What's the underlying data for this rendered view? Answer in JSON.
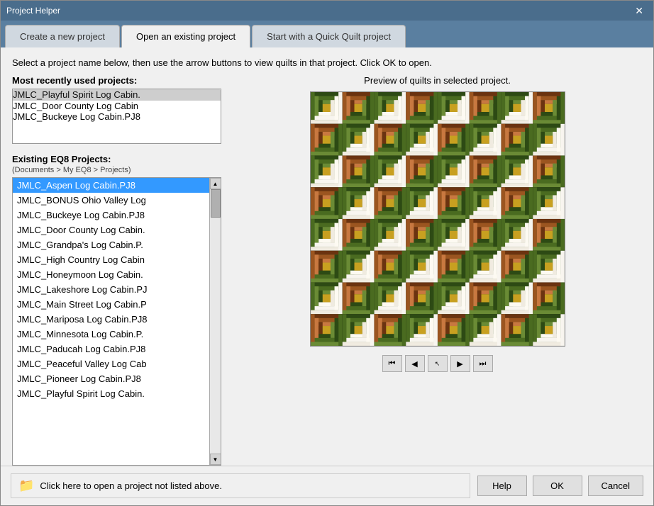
{
  "window": {
    "title": "Project Helper",
    "close_label": "✕"
  },
  "tabs": [
    {
      "id": "new",
      "label": "Create a new project",
      "active": false
    },
    {
      "id": "open",
      "label": "Open an existing project",
      "active": true
    },
    {
      "id": "quick",
      "label": "Start with a Quick Quilt project",
      "active": false
    }
  ],
  "instruction": "Select a project name below, then use the arrow buttons to view quilts in that project. Click OK to open.",
  "recent_section": {
    "label": "Most recently used projects:",
    "items": [
      "JMLC_Playful Spirit Log Cabin.",
      "JMLC_Door County Log Cabin",
      "JMLC_Buckeye Log Cabin.PJ8"
    ]
  },
  "existing_section": {
    "label": "Existing EQ8 Projects:",
    "sublabel": "(Documents > My EQ8 > Projects)",
    "items": [
      "JMLC_Aspen Log Cabin.PJ8",
      "JMLC_BONUS Ohio Valley Log",
      "JMLC_Buckeye Log Cabin.PJ8",
      "JMLC_Door County Log Cabin.",
      "JMLC_Grandpa's Log Cabin.P.",
      "JMLC_High Country Log Cabin",
      "JMLC_Honeymoon Log Cabin.",
      "JMLC_Lakeshore Log Cabin.PJ",
      "JMLC_Main Street Log Cabin.P",
      "JMLC_Mariposa Log Cabin.PJ8",
      "JMLC_Minnesota Log Cabin.P.",
      "JMLC_Paducah Log Cabin.PJ8",
      "JMLC_Peaceful Valley Log Cab",
      "JMLC_Pioneer Log Cabin.PJ8",
      "JMLC_Playful Spirit Log Cabin."
    ],
    "selected_index": 0
  },
  "preview": {
    "label": "Preview of quilts in selected project."
  },
  "nav": {
    "first": "⏮",
    "prev": "◀",
    "cursor": "↖",
    "next": "▶",
    "last": "⏭"
  },
  "footer": {
    "open_label": "Click here to open a project not listed above.",
    "help_label": "Help",
    "ok_label": "OK",
    "cancel_label": "Cancel"
  }
}
